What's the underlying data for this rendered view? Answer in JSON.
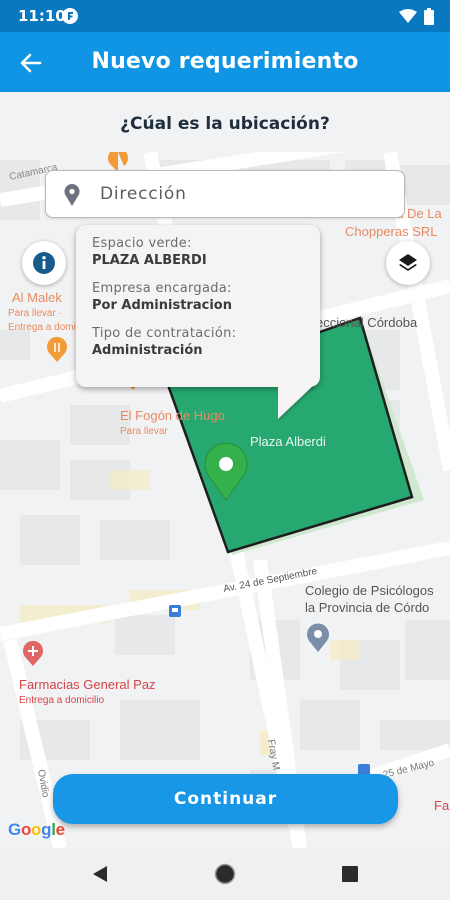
{
  "status_bar": {
    "time": "11:10"
  },
  "app_bar": {
    "title": "Nuevo requerimiento"
  },
  "question": "¿Cúal es la ubicación?",
  "address": {
    "placeholder": "Dirección",
    "value": ""
  },
  "map": {
    "labels": {
      "catamarca": "Catamarca",
      "la_casa": "La Casa De La",
      "chopperas": "Chopperas SRL",
      "al_malek": "Al Malek",
      "al_malek_sub1": "Para llevar ·",
      "al_malek_sub2": "Entrega a domicilio",
      "fogon": "El Fogón de Hugo",
      "fogon_sub": "Para llevar",
      "plaza": "Plaza Alberdi",
      "seccional": "eccional Córdoba",
      "avenida": "Av. 24 de Septiembre",
      "colegio1": "Colegio de Psicólogos",
      "colegio2": "la Provincia de Córdo",
      "farmacias": "Farmacias General Paz",
      "farmacias_sub": "Entrega a domicilio",
      "fray": "Fray M",
      "ovidio": "Ovidio",
      "mayo": "25 de Mayo",
      "fa": "Fa"
    },
    "plaza_fill": "#27a870"
  },
  "callout": {
    "fields": [
      {
        "label": "Espacio verde:",
        "value": "PLAZA ALBERDI"
      },
      {
        "label": "Empresa encargada:",
        "value": "Por Administracion"
      },
      {
        "label": "Tipo de contratación:",
        "value": "Administración"
      }
    ]
  },
  "continue_label": "Continuar",
  "google": {
    "g1": "G",
    "o1": "o",
    "o2": "o",
    "g2": "g",
    "l": "l",
    "e": "e"
  },
  "colors": {
    "status_bar": "#0a78bf",
    "app_bar": "#0f95e3",
    "accent": "#1797e6",
    "plaza": "#27a870"
  },
  "icons": [
    "back-arrow-icon",
    "location-pin-icon",
    "info-icon",
    "layers-icon",
    "map-marker-icon",
    "nav-back-icon",
    "nav-home-icon",
    "nav-recents-icon"
  ]
}
